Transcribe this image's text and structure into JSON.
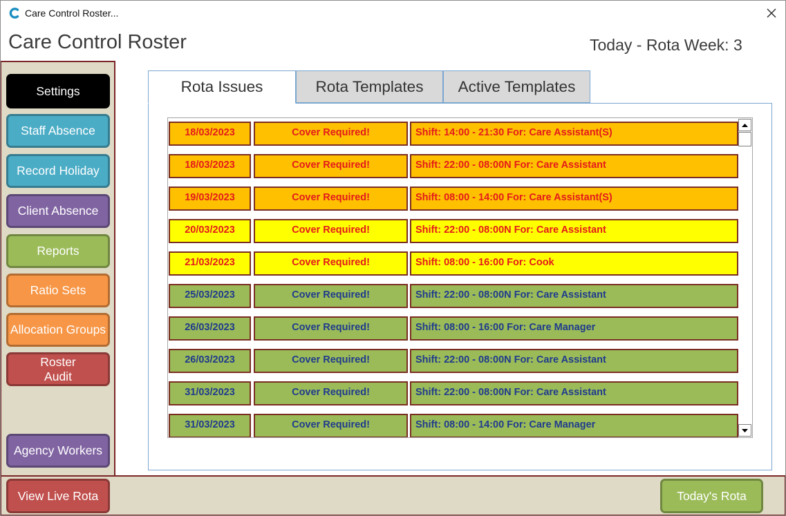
{
  "window": {
    "title": "Care Control Roster...",
    "icons": {
      "app_logo": "app-logo-icon",
      "close": "close-icon"
    }
  },
  "header": {
    "title": "Care Control Roster",
    "rota_week": "Today - Rota Week: 3"
  },
  "sidebar": {
    "items": [
      {
        "label": "Settings",
        "color": "#000000"
      },
      {
        "label": "Staff Absence",
        "color": "#4bacc6"
      },
      {
        "label": "Record Holiday",
        "color": "#4bacc6"
      },
      {
        "label": "Client Absence",
        "color": "#8064a2"
      },
      {
        "label": "Reports",
        "color": "#9bbb59"
      },
      {
        "label": "Ratio Sets",
        "color": "#f79646"
      },
      {
        "label": "Allocation Groups",
        "color": "#f79646"
      },
      {
        "label": "Roster\nAudit",
        "color": "#c0504d"
      },
      {
        "label": "Agency Workers",
        "color": "#8064a2"
      }
    ]
  },
  "tabs": [
    {
      "label": "Rota Issues",
      "active": true
    },
    {
      "label": "Rota Templates",
      "active": false
    },
    {
      "label": "Active Templates",
      "active": false
    }
  ],
  "rota_issues": [
    {
      "date": "18/03/2023",
      "status": "Cover Required!",
      "shift": "Shift: 14:00 - 21:30 For: Care Assistant(S)",
      "row_color": "#ffc000",
      "text_color": "#e31a1c"
    },
    {
      "date": "18/03/2023",
      "status": "Cover Required!",
      "shift": "Shift: 22:00 - 08:00N For: Care Assistant",
      "row_color": "#ffc000",
      "text_color": "#e31a1c"
    },
    {
      "date": "19/03/2023",
      "status": "Cover Required!",
      "shift": "Shift: 08:00 - 14:00 For: Care Assistant(S)",
      "row_color": "#ffc000",
      "text_color": "#e31a1c"
    },
    {
      "date": "20/03/2023",
      "status": "Cover Required!",
      "shift": "Shift: 22:00 - 08:00N For: Care Assistant",
      "row_color": "#ffff00",
      "text_color": "#e31a1c"
    },
    {
      "date": "21/03/2023",
      "status": "Cover Required!",
      "shift": "Shift: 08:00 - 16:00 For: Cook",
      "row_color": "#ffff00",
      "text_color": "#e31a1c"
    },
    {
      "date": "25/03/2023",
      "status": "Cover Required!",
      "shift": "Shift: 22:00 - 08:00N For: Care Assistant",
      "row_color": "#9bbb59",
      "text_color": "#1f3b8c"
    },
    {
      "date": "26/03/2023",
      "status": "Cover Required!",
      "shift": "Shift: 08:00 - 16:00 For: Care Manager",
      "row_color": "#9bbb59",
      "text_color": "#1f3b8c"
    },
    {
      "date": "26/03/2023",
      "status": "Cover Required!",
      "shift": "Shift: 22:00 - 08:00N For: Care Assistant",
      "row_color": "#9bbb59",
      "text_color": "#1f3b8c"
    },
    {
      "date": "31/03/2023",
      "status": "Cover Required!",
      "shift": "Shift: 22:00 - 08:00N For: Care Assistant",
      "row_color": "#9bbb59",
      "text_color": "#1f3b8c"
    },
    {
      "date": "31/03/2023",
      "status": "Cover Required!",
      "shift": "Shift: 08:00 - 14:00 For: Care Manager",
      "row_color": "#9bbb59",
      "text_color": "#1f3b8c"
    }
  ],
  "list_scrollbar": {
    "up_icon": "scroll-up-icon",
    "down_icon": "scroll-down-icon"
  },
  "footer": {
    "view_live_rota": {
      "label": "View Live Rota",
      "color": "#c0504d"
    },
    "todays_rota": {
      "label": "Today's Rota",
      "color": "#9bbb59"
    }
  }
}
